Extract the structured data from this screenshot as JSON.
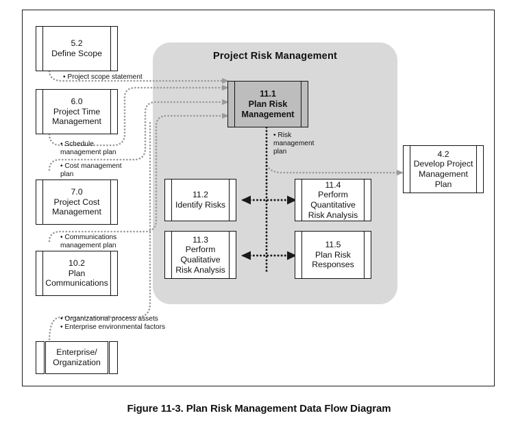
{
  "figure": {
    "caption": "Figure 11-3. Plan Risk Management Data Flow Diagram",
    "panel_title": "Project Risk Management",
    "colors": {
      "panel_fill": "#d9d9d9",
      "focus_box_fill": "#bdbdbd",
      "box_fill": "#ffffff",
      "stroke": "#111111",
      "grey_flow": "#9a9a9a",
      "black_flow": "#1a1a1a"
    }
  },
  "external_processes": [
    {
      "id": "5.2",
      "number": "5.2",
      "name": "Define Scope"
    },
    {
      "id": "6.0",
      "number": "6.0",
      "name": "Project Time\nManagement"
    },
    {
      "id": "7.0",
      "number": "7.0",
      "name": "Project Cost\nManagement"
    },
    {
      "id": "10.2",
      "number": "10.2",
      "name": "Plan\nCommunications"
    },
    {
      "id": "4.2",
      "number": "4.2",
      "name": "Develop Project\nManagement\nPlan"
    }
  ],
  "external_entity": {
    "id": "enterprise",
    "name": "Enterprise/\nOrganization"
  },
  "panel_processes": [
    {
      "id": "11.1",
      "number": "11.1",
      "name": "Plan Risk\nManagement",
      "shaded": true
    },
    {
      "id": "11.2",
      "number": "11.2",
      "name": "Identify Risks",
      "shaded": false
    },
    {
      "id": "11.3",
      "number": "11.3",
      "name": "Perform\nQualitative\nRisk Analysis",
      "shaded": false
    },
    {
      "id": "11.4",
      "number": "11.4",
      "name": "Perform\nQuantitative\nRisk Analysis",
      "shaded": false
    },
    {
      "id": "11.5",
      "number": "11.5",
      "name": "Plan Risk\nResponses",
      "shaded": false
    }
  ],
  "box_text": {
    "b52": "5.2\nDefine Scope",
    "b60": "6.0\nProject Time\nManagement",
    "b70": "7.0\nProject Cost\nManagement",
    "b102": "10.2\nPlan\nCommunications",
    "b42": "4.2\nDevelop Project\nManagement\nPlan",
    "bent": "Enterprise/\nOrganization",
    "b111": "11.1\nPlan Risk\nManagement",
    "b112": "11.2\nIdentify Risks",
    "b113": "11.3\nPerform\nQualitative\nRisk Analysis",
    "b114": "11.4\nPerform\nQuantitative\nRisk Analysis",
    "b115": "11.5\nPlan Risk\nResponses"
  },
  "flow_labels": {
    "project_scope_statement": "• Project scope statement",
    "schedule_management_plan": "• Schedule\n   management plan",
    "cost_management_plan": "• Cost management\n   plan",
    "communications_management_plan": "• Communications\n   management plan",
    "org_and_enterprise": "• Organizational process assets\n• Enterprise environmental factors",
    "risk_management_plan": "• Risk\n   management\n   plan"
  },
  "chart_data": {
    "type": "diagram",
    "title": "Plan Risk Management Data Flow Diagram",
    "nodes": [
      {
        "id": "5.2",
        "label": "5.2 Define Scope",
        "group": "external"
      },
      {
        "id": "6.0",
        "label": "6.0 Project Time Management",
        "group": "external"
      },
      {
        "id": "7.0",
        "label": "7.0 Project Cost Management",
        "group": "external"
      },
      {
        "id": "10.2",
        "label": "10.2 Plan Communications",
        "group": "external"
      },
      {
        "id": "enterprise",
        "label": "Enterprise/Organization",
        "group": "entity"
      },
      {
        "id": "11.1",
        "label": "11.1 Plan Risk Management",
        "group": "Project Risk Management"
      },
      {
        "id": "11.2",
        "label": "11.2 Identify Risks",
        "group": "Project Risk Management"
      },
      {
        "id": "11.3",
        "label": "11.3 Perform Qualitative Risk Analysis",
        "group": "Project Risk Management"
      },
      {
        "id": "11.4",
        "label": "11.4 Perform Quantitative Risk Analysis",
        "group": "Project Risk Management"
      },
      {
        "id": "11.5",
        "label": "11.5 Plan Risk Responses",
        "group": "Project Risk Management"
      },
      {
        "id": "4.2",
        "label": "4.2 Develop Project Management Plan",
        "group": "external"
      }
    ],
    "edges": [
      {
        "from": "5.2",
        "to": "11.1",
        "label": "Project scope statement",
        "style": "grey-dotted-arrow"
      },
      {
        "from": "6.0",
        "to": "11.1",
        "label": "Schedule management plan",
        "style": "grey-dotted-arrow"
      },
      {
        "from": "7.0",
        "to": "11.1",
        "label": "Cost management plan",
        "style": "grey-dotted-arrow"
      },
      {
        "from": "10.2",
        "to": "11.1",
        "label": "Communications management plan",
        "style": "grey-dotted-arrow"
      },
      {
        "from": "enterprise",
        "to": "11.1",
        "label": "Organizational process assets; Enterprise environmental factors",
        "style": "grey-dotted-arrow"
      },
      {
        "from": "11.1",
        "to": "4.2",
        "label": "Risk management plan",
        "style": "grey-dotted-arrow"
      },
      {
        "from": "11.1",
        "to": "11.2",
        "label": "Risk management plan",
        "style": "black-dotted"
      },
      {
        "from": "11.1",
        "to": "11.3",
        "label": "Risk management plan",
        "style": "black-dotted"
      },
      {
        "from": "11.1",
        "to": "11.4",
        "label": "Risk management plan",
        "style": "black-dotted"
      },
      {
        "from": "11.1",
        "to": "11.5",
        "label": "Risk management plan",
        "style": "black-dotted"
      },
      {
        "from": "11.2",
        "to": "11.4",
        "label": "",
        "style": "black-dotted-double-arrow"
      },
      {
        "from": "11.3",
        "to": "11.5",
        "label": "",
        "style": "black-dotted-double-arrow"
      }
    ]
  }
}
